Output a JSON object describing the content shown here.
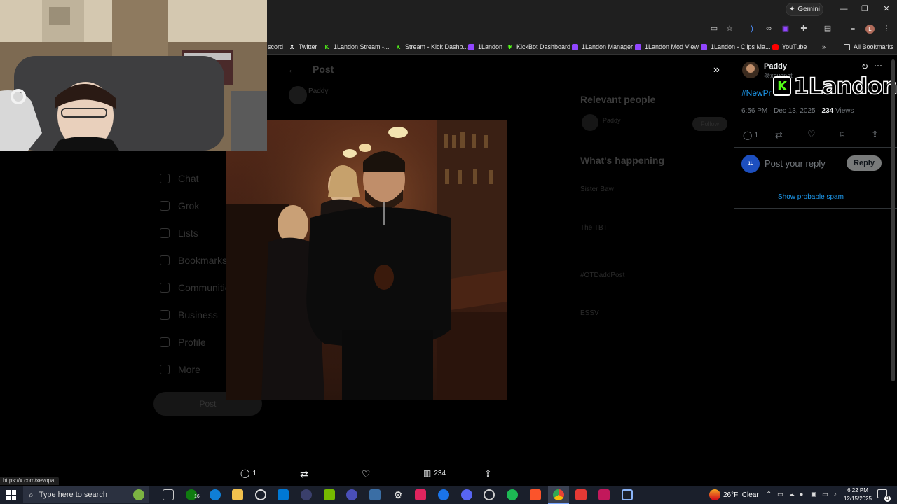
{
  "browser": {
    "gemini_label": "Gemini",
    "bookmarks": [
      {
        "label": "scord",
        "color": "#5865f2"
      },
      {
        "label": "Twitter",
        "color": "#ffffff"
      },
      {
        "label": "1Landon Stream -...",
        "color": "#53fc18"
      },
      {
        "label": "Stream - Kick Dashb...",
        "color": "#53fc18"
      },
      {
        "label": "1Landon",
        "color": "#9146ff"
      },
      {
        "label": "KickBot Dashboard",
        "color": "#53fc18"
      },
      {
        "label": "1Landon Manager",
        "color": "#9146ff"
      },
      {
        "label": "1Landon Mod View",
        "color": "#9146ff"
      },
      {
        "label": "1Landon - Clips Ma...",
        "color": "#9146ff"
      },
      {
        "label": "YouTube",
        "color": "#ff0000"
      }
    ],
    "all_bookmarks": "All Bookmarks",
    "status_url": "https://x.com/xevopat"
  },
  "dimmed": {
    "post_title": "Post",
    "author_dim": "Paddy",
    "nav": [
      "Chat",
      "Grok",
      "Lists",
      "Bookmarks",
      "Communities",
      "Business",
      "Profile",
      "More"
    ],
    "post_button": "Post",
    "relevant_people": "Relevant people",
    "follow": "Follow",
    "whats_happening": "What's happening",
    "trends": [
      "Sister Baw",
      "The TBT",
      "#OTDaddPost",
      "ESSV"
    ]
  },
  "overlay_logo": "1Landon",
  "right_panel": {
    "author_name": "Paddy",
    "handle": "@xevopat",
    "hashtag": "#NewPr",
    "timestamp": "6:56 PM · Dec 13, 2025 · ",
    "views_count": "234",
    "views_label": " Views",
    "reply_count": "1",
    "reply_placeholder": "Post your reply",
    "reply_button": "Reply",
    "show_spam": "Show probable spam"
  },
  "actions": {
    "replies": "1",
    "views": "234"
  },
  "taskbar": {
    "search_placeholder": "Type here to search",
    "badge": "16",
    "weather": "26°F  Clear",
    "time": "6:22 PM",
    "date": "12/15/2025",
    "notif_count": "3"
  },
  "colors": {
    "accent": "#1d9bf0",
    "kick_green": "#53fc18",
    "reply_btn": "#787a7a"
  }
}
